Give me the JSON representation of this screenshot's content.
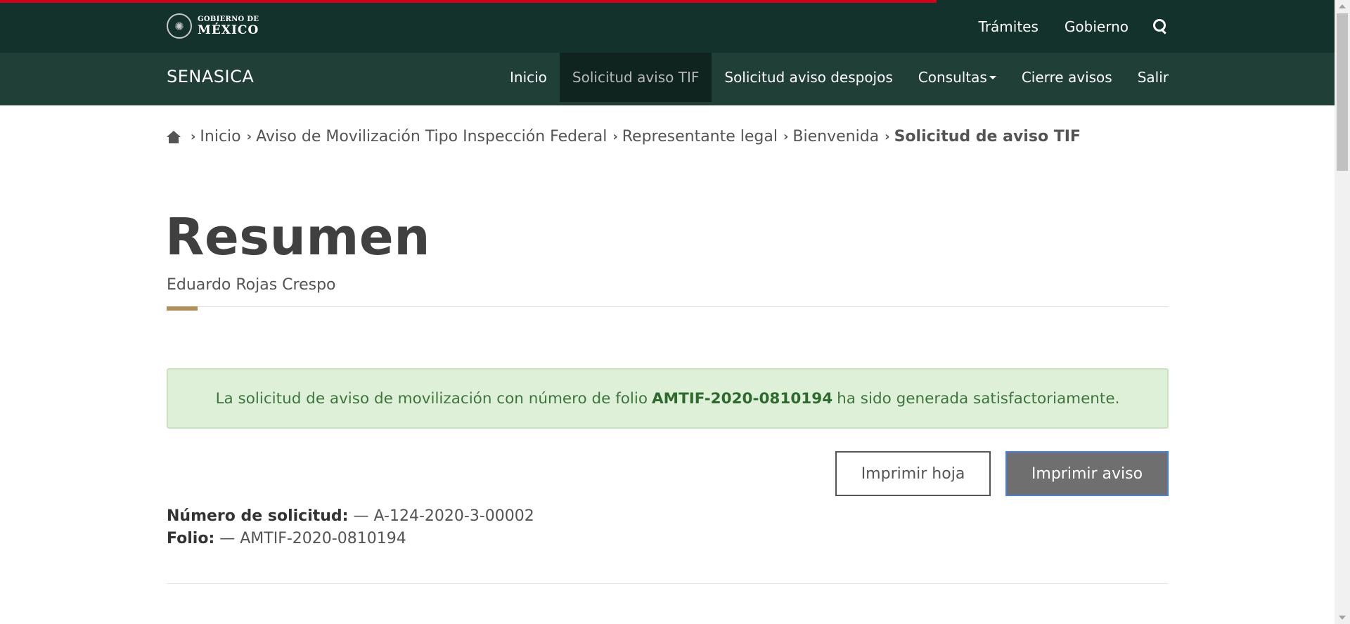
{
  "loading_progress": 0.694,
  "colors": {
    "top_bar": "#13322b",
    "nav_bar": "#1f3f37",
    "progress": "#d0021b",
    "accent": "#b38e5d",
    "alert_bg": "#dff0d8",
    "alert_text": "#3c763d"
  },
  "top_bar": {
    "logo_line1": "GOBIERNO DE",
    "logo_line2": "MÉXICO",
    "links": [
      "Trámites",
      "Gobierno"
    ],
    "search_icon": "search-icon"
  },
  "nav": {
    "brand": "SENASICA",
    "items": [
      {
        "label": "Inicio"
      },
      {
        "label": "Solicitud aviso TIF"
      },
      {
        "label": "Solicitud aviso despojos"
      },
      {
        "label": "Consultas"
      },
      {
        "label": "Cierre avisos"
      },
      {
        "label": "Salir"
      }
    ],
    "active": "Solicitud aviso TIF"
  },
  "breadcrumb": {
    "home_icon": "home-icon",
    "items": [
      "Inicio",
      "Aviso de Movilización Tipo Inspección Federal",
      "Representante legal",
      "Bienvenida"
    ],
    "current": "Solicitud de aviso TIF"
  },
  "page": {
    "title": "Resumen",
    "subtitle": "Eduardo Rojas Crespo"
  },
  "alert": {
    "prefix": "La solicitud de aviso de movilización con número de folio",
    "folio": "AMTIF-2020-0810194",
    "suffix": "ha sido generada satisfactoriamente."
  },
  "buttons": {
    "print_sheet": "Imprimir hoja",
    "print_notice": "Imprimir aviso"
  },
  "details": {
    "request_label": "Número de solicitud:",
    "request_value": "— A-124-2020-3-00002",
    "folio_label": "Folio:",
    "folio_value": "— AMTIF-2020-0810194"
  }
}
